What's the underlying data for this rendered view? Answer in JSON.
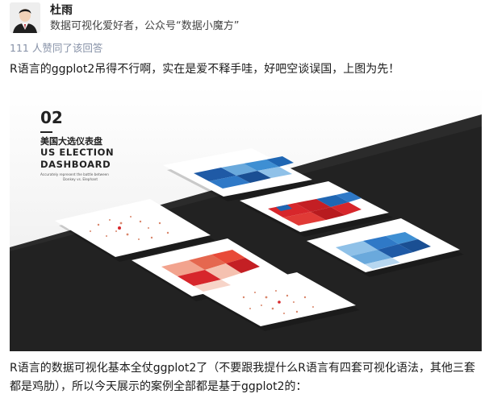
{
  "author": {
    "name": "杜雨",
    "bio": "数据可视化爱好者，公众号“数据小魔方”"
  },
  "votes": {
    "text": "111 人赞同了该回答"
  },
  "paragraphs": {
    "first": "R语言的ggplot2吊得不行啊，实在是爱不释手哇，好吧空谈误国，上图为先！",
    "second": "R语言的数据可视化基本全仗ggplot2了（不要跟我提什么R语言有四套可视化语法，其他三套都是鸡肋），所以今天展示的案例全部都是基于ggplot2的："
  },
  "figure": {
    "number": "02",
    "title_cn": "美国大选仪表盘",
    "title_en_1": "US ELECTION",
    "title_en_2": "DASHBOARD",
    "caption_1": "Accurately represent the battle between",
    "caption_2": "Donkey vs. Elephant"
  },
  "colors": {
    "background": "#ffffff",
    "meta_text": "#8590a6",
    "republican_red": "#d7262b",
    "democrat_blue": "#1f66b3",
    "panel": "#ffffff",
    "dark_band": "#2b2b2b"
  },
  "icons": {
    "avatar": "avatar-portrait"
  }
}
